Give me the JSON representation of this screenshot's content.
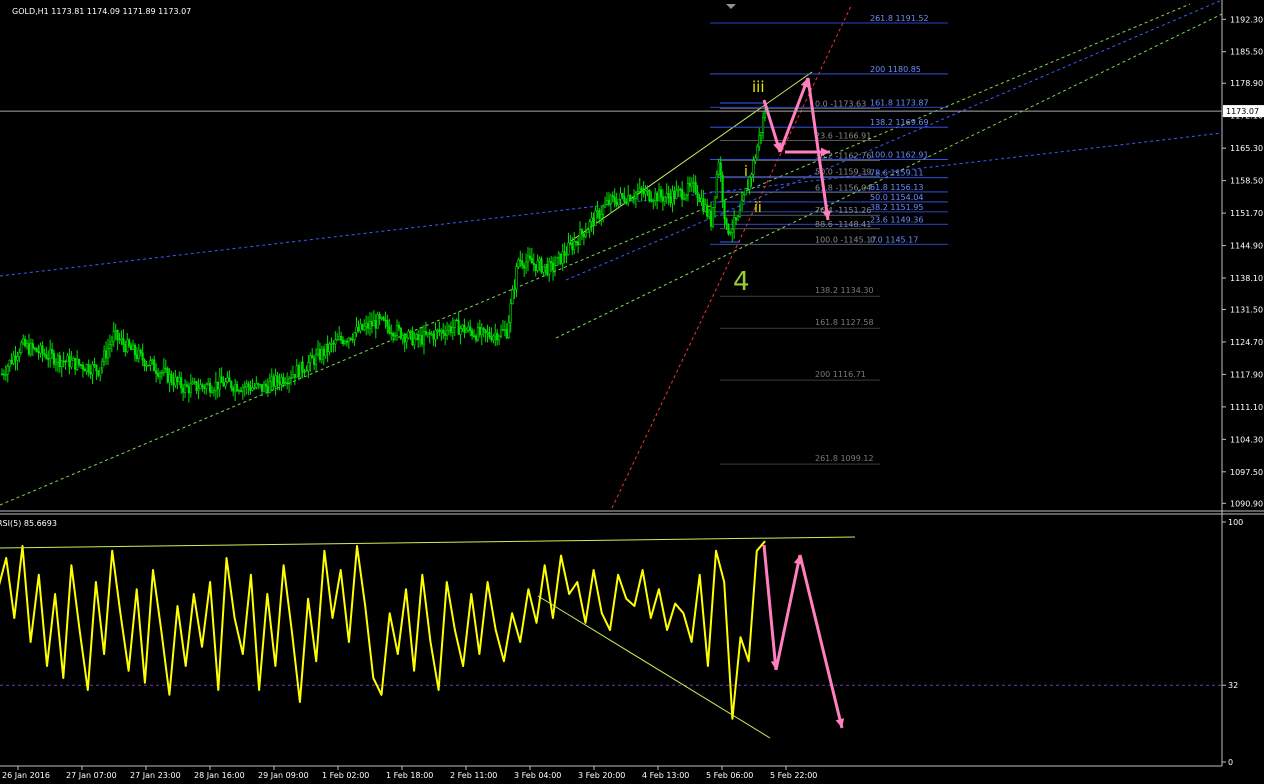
{
  "header": {
    "symbol_line": "GOLD,H1  1173.81 1174.09 1171.89 1173.07",
    "menu_icon": "triangle-down-icon"
  },
  "rsi_header": "RSI(5) 85.6693",
  "price_label": "1173.07",
  "colors": {
    "background": "#000000",
    "candle": "#00e000",
    "rsi_line": "#ffff00",
    "trend": "#c8f05a",
    "fib_blue": "#3a5cff",
    "fib_gray": "#8a8a8a",
    "projection": "#ff7fbf",
    "wave_yellow": "#e6e600",
    "wave_green": "#9acd32",
    "red_line": "#ff3030"
  },
  "chart_data": [
    {
      "type": "candlestick",
      "title": "GOLD,H1",
      "y_ticks": [
        "1192.30",
        "1185.50",
        "1178.90",
        "1172.10",
        "1165.30",
        "1158.50",
        "1151.70",
        "1144.90",
        "1138.10",
        "1131.50",
        "1124.70",
        "1117.90",
        "1111.10",
        "1104.30",
        "1097.50",
        "1090.90"
      ],
      "ylim": [
        1089.5,
        1195.5
      ],
      "x_ticks": [
        "26 Jan 2016",
        "27 Jan 07:00",
        "27 Jan 23:00",
        "28 Jan 16:00",
        "29 Jan 09:00",
        "1 Feb 02:00",
        "1 Feb 18:00",
        "2 Feb 11:00",
        "3 Feb 04:00",
        "3 Feb 20:00",
        "4 Feb 13:00",
        "5 Feb 06:00",
        "5 Feb 22:00"
      ],
      "close_anchors": [
        [
          0,
          1118
        ],
        [
          10,
          1124
        ],
        [
          30,
          1121
        ],
        [
          50,
          1119
        ],
        [
          58,
          1126
        ],
        [
          70,
          1122
        ],
        [
          95,
          1115
        ],
        [
          115,
          1116
        ],
        [
          135,
          1115
        ],
        [
          155,
          1119
        ],
        [
          175,
          1125
        ],
        [
          195,
          1129
        ],
        [
          215,
          1125
        ],
        [
          235,
          1128
        ],
        [
          250,
          1126
        ],
        [
          262,
          1127
        ],
        [
          268,
          1142
        ],
        [
          285,
          1140
        ],
        [
          300,
          1147
        ],
        [
          315,
          1154
        ],
        [
          330,
          1156
        ],
        [
          345,
          1155
        ],
        [
          360,
          1157
        ],
        [
          368,
          1150
        ],
        [
          372,
          1163
        ],
        [
          376,
          1148
        ],
        [
          382,
          1150
        ],
        [
          390,
          1162
        ],
        [
          396,
          1173
        ]
      ],
      "fib_levels": [
        {
          "ratio": "261.8",
          "value": 1191.52
        },
        {
          "ratio": "200",
          "value": 1180.85
        },
        {
          "ratio": "161.8",
          "value": 1173.87
        },
        {
          "ratio": "138.2",
          "value": 1169.69
        },
        {
          "ratio": "100.0",
          "value": 1162.91
        },
        {
          "ratio": "78.6",
          "value": 1159.11
        },
        {
          "ratio": "61.8",
          "value": 1156.13
        },
        {
          "ratio": "50.0",
          "value": 1154.04
        },
        {
          "ratio": "38.2",
          "value": 1151.95
        },
        {
          "ratio": "23.6",
          "value": 1149.36
        },
        {
          "ratio": "0.0",
          "value": 1145.17
        }
      ],
      "retracement_levels": [
        {
          "ratio": "0.0",
          "value": 1173.63
        },
        {
          "ratio": "23.6",
          "value": 1166.91
        },
        {
          "ratio": "38.2",
          "value": 1162.76
        },
        {
          "ratio": "50.0",
          "value": 1159.39
        },
        {
          "ratio": "61.8",
          "value": 1156.04
        },
        {
          "ratio": "76.4",
          "value": 1151.26
        },
        {
          "ratio": "88.6",
          "value": 1148.41
        },
        {
          "ratio": "100.0",
          "value": 1145.17
        }
      ],
      "extension_levels": [
        {
          "ratio": "138.2",
          "value": 1134.3
        },
        {
          "ratio": "161.8",
          "value": 1127.58
        },
        {
          "ratio": "200",
          "value": 1116.71
        },
        {
          "ratio": "261.8",
          "value": 1099.12
        }
      ],
      "wave_labels": [
        "iii",
        "i",
        "ii",
        "4"
      ]
    },
    {
      "type": "line",
      "title": "RSI(5) 85.6693",
      "y_ticks": [
        "100",
        "32",
        "0"
      ],
      "ylim": [
        0,
        100
      ],
      "level": 32,
      "anchors": [
        [
          0,
          72
        ],
        [
          4,
          85
        ],
        [
          8,
          60
        ],
        [
          12,
          90
        ],
        [
          16,
          50
        ],
        [
          20,
          78
        ],
        [
          24,
          40
        ],
        [
          28,
          70
        ],
        [
          32,
          35
        ],
        [
          36,
          82
        ],
        [
          40,
          55
        ],
        [
          44,
          30
        ],
        [
          48,
          75
        ],
        [
          52,
          45
        ],
        [
          56,
          88
        ],
        [
          60,
          62
        ],
        [
          64,
          38
        ],
        [
          68,
          72
        ],
        [
          72,
          33
        ],
        [
          76,
          80
        ],
        [
          80,
          55
        ],
        [
          84,
          28
        ],
        [
          88,
          65
        ],
        [
          92,
          40
        ],
        [
          96,
          70
        ],
        [
          100,
          48
        ],
        [
          104,
          75
        ],
        [
          108,
          30
        ],
        [
          112,
          85
        ],
        [
          116,
          60
        ],
        [
          120,
          45
        ],
        [
          124,
          78
        ],
        [
          128,
          30
        ],
        [
          132,
          70
        ],
        [
          136,
          40
        ],
        [
          140,
          82
        ],
        [
          144,
          55
        ],
        [
          148,
          25
        ],
        [
          152,
          68
        ],
        [
          156,
          42
        ],
        [
          160,
          88
        ],
        [
          164,
          60
        ],
        [
          168,
          80
        ],
        [
          172,
          50
        ],
        [
          176,
          90
        ],
        [
          180,
          65
        ],
        [
          184,
          35
        ],
        [
          188,
          28
        ],
        [
          192,
          62
        ],
        [
          196,
          45
        ],
        [
          200,
          72
        ],
        [
          204,
          38
        ],
        [
          208,
          78
        ],
        [
          212,
          50
        ],
        [
          216,
          30
        ],
        [
          220,
          75
        ],
        [
          224,
          55
        ],
        [
          228,
          40
        ],
        [
          232,
          70
        ],
        [
          236,
          45
        ],
        [
          240,
          75
        ],
        [
          244,
          55
        ],
        [
          248,
          42
        ],
        [
          252,
          62
        ],
        [
          256,
          50
        ],
        [
          260,
          72
        ],
        [
          264,
          58
        ],
        [
          268,
          82
        ],
        [
          272,
          60
        ],
        [
          276,
          86
        ],
        [
          280,
          70
        ],
        [
          284,
          75
        ],
        [
          288,
          58
        ],
        [
          292,
          80
        ],
        [
          296,
          62
        ],
        [
          300,
          55
        ],
        [
          304,
          78
        ],
        [
          308,
          68
        ],
        [
          312,
          65
        ],
        [
          316,
          80
        ],
        [
          320,
          60
        ],
        [
          324,
          72
        ],
        [
          328,
          55
        ],
        [
          332,
          66
        ],
        [
          336,
          62
        ],
        [
          340,
          50
        ],
        [
          344,
          78
        ],
        [
          348,
          40
        ],
        [
          352,
          88
        ],
        [
          356,
          75
        ],
        [
          360,
          18
        ],
        [
          364,
          52
        ],
        [
          368,
          42
        ],
        [
          372,
          88
        ],
        [
          376,
          92
        ]
      ]
    }
  ]
}
